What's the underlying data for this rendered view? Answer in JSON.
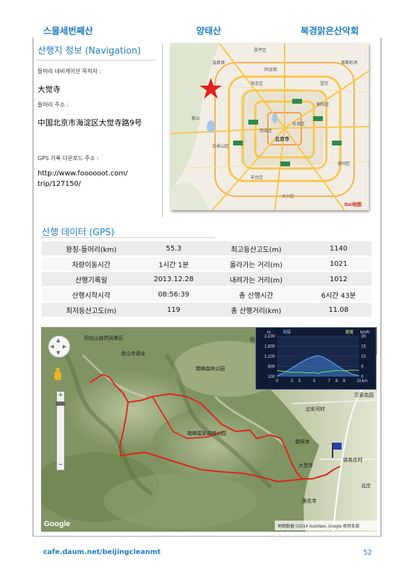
{
  "header": {
    "left": "스물세번째산",
    "middle": "양태산",
    "right": "북경맑은산악회"
  },
  "nav_info": {
    "title": "산행지 정보 (Navigation)",
    "dest_label": "들머리 네비게이션 목적지 :",
    "dest_value": "大觉寺",
    "addr_label": "들머리 주소 :",
    "addr_value": "中国北京市海淀区大觉寺路9号",
    "gps_label": "GPS 기록 다운로드 주소 :",
    "gps_url_line1": "http://www.foooooot.com/",
    "gps_url_line2": "trip/127150/"
  },
  "thumb_map": {
    "center_label": "北京市",
    "logo": "Bai地图",
    "labels": [
      "温泉镇",
      "香山",
      "海淀区",
      "朝阳区",
      "丰台区",
      "石景山区",
      "西城区",
      "东城区",
      "通州区",
      "大兴区",
      "昌平区",
      "回龙观",
      "望京",
      "首都机场"
    ]
  },
  "gps_data": {
    "title": "산행 데이터 (GPS)",
    "rows": [
      [
        "왕징-들머리(km)",
        "55.3",
        "최고등산고도(m)",
        "1140"
      ],
      [
        "차량이동시간",
        "1시간 1분",
        "올라가는 거리(m)",
        "1021"
      ],
      [
        "산행기록일",
        "2013.12.28",
        "내려가는 거리(m)",
        "1012"
      ],
      [
        "산행시작시각",
        "08:56:39",
        "총 산행시간",
        "6시간 43분"
      ],
      [
        "최저등산고도(m)",
        "119",
        "총 산행거리(km)",
        "11.08"
      ]
    ]
  },
  "track_map": {
    "labels": {
      "park1": "阳台山自然风景区",
      "park2": "金山寺遗址",
      "park3": "鹫峰森林公园",
      "park4": "鹫峰国家森林公园",
      "temple1": "普照寺",
      "temple2": "大觉寺",
      "temple3": "莲花寺",
      "village": "徐各庄村",
      "village2": "北安河村",
      "area": "阳台风景区",
      "road": "贝家花园",
      "road2": "北庄"
    },
    "zoom_plus": "+",
    "zoom_minus": "−",
    "google_logo": "Google",
    "copyright": "地图数据 ©2014 AutoNavi, Google  使用条款",
    "chart": {
      "legend_altitude": "海拔",
      "legend_speed": "速度",
      "unit_m": "m",
      "unit_kmh": "km/h",
      "y_left": [
        "2,100",
        "1,600",
        "1,100",
        "600",
        "100"
      ],
      "y_right": [
        "20",
        "15",
        "10",
        "5",
        "0"
      ],
      "x_ticks": [
        "0",
        "2",
        "3",
        "5",
        "7",
        "8",
        "9",
        "11"
      ],
      "x_unit": "km"
    }
  },
  "footer": {
    "link": "cafe.daum.net/beijingcleanmt",
    "page": "52"
  },
  "chart_data": {
    "type": "area",
    "x": [
      0,
      1,
      2,
      3,
      4,
      5,
      5.5,
      6,
      7,
      8,
      9,
      10,
      11
    ],
    "series": [
      {
        "name": "海拔",
        "values": [
          120,
          300,
          520,
          760,
          960,
          1100,
          1140,
          1090,
          900,
          650,
          420,
          230,
          130
        ]
      },
      {
        "name": "速度",
        "values": [
          3,
          2.5,
          2,
          2.2,
          1.8,
          2,
          1.5,
          2.2,
          2.5,
          3,
          2.8,
          3.2,
          3
        ]
      }
    ],
    "title": "",
    "xlabel": "km",
    "ylabel_left": "m",
    "ylabel_right": "km/h",
    "ylim_left": [
      100,
      2100
    ],
    "ylim_right": [
      0,
      20
    ],
    "grid": true
  }
}
